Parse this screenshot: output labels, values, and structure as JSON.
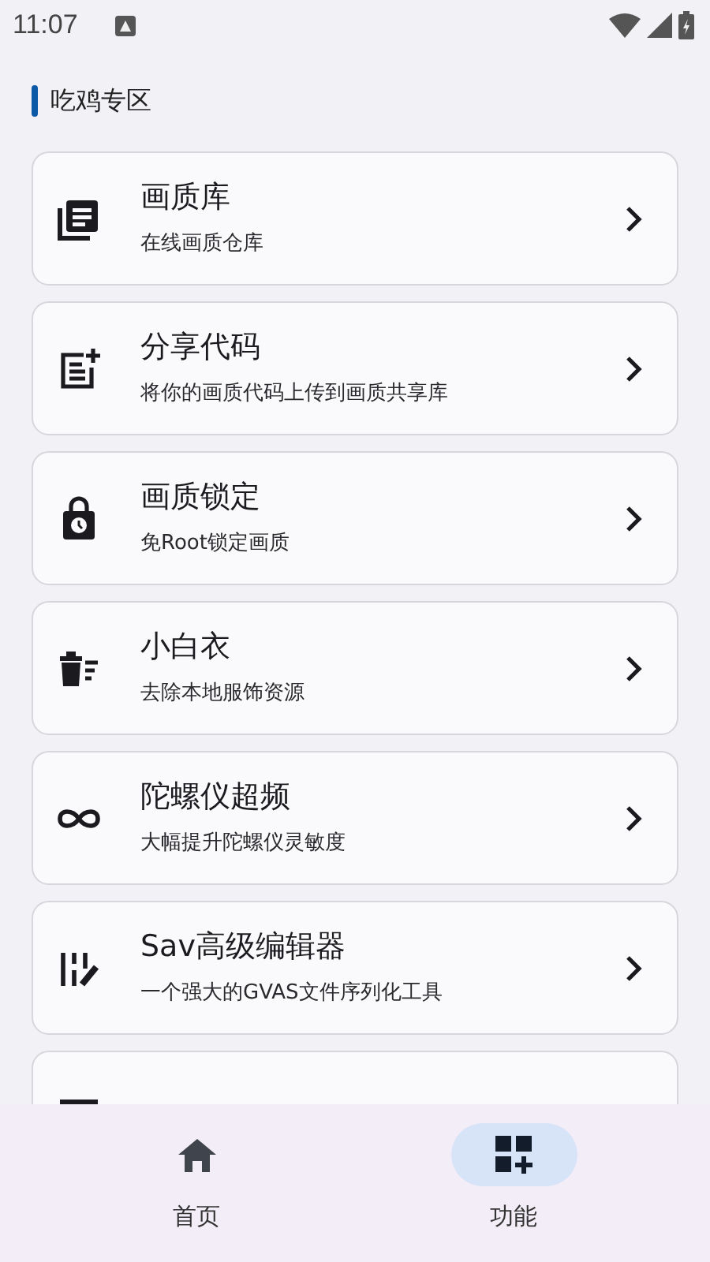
{
  "status_bar": {
    "time": "11:07"
  },
  "section": {
    "title": "吃鸡专区"
  },
  "features": [
    {
      "title": "画质库",
      "subtitle": "在线画质仓库"
    },
    {
      "title": "分享代码",
      "subtitle": "将你的画质代码上传到画质共享库"
    },
    {
      "title": "画质锁定",
      "subtitle": "免Root锁定画质"
    },
    {
      "title": "小白衣",
      "subtitle": "去除本地服饰资源"
    },
    {
      "title": "陀螺仪超频",
      "subtitle": "大幅提升陀螺仪灵敏度"
    },
    {
      "title": "Sav高级编辑器",
      "subtitle": "一个强大的GVAS文件序列化工具"
    }
  ],
  "bottom_nav": [
    {
      "label": "首页",
      "selected": false
    },
    {
      "label": "功能",
      "selected": true
    }
  ]
}
